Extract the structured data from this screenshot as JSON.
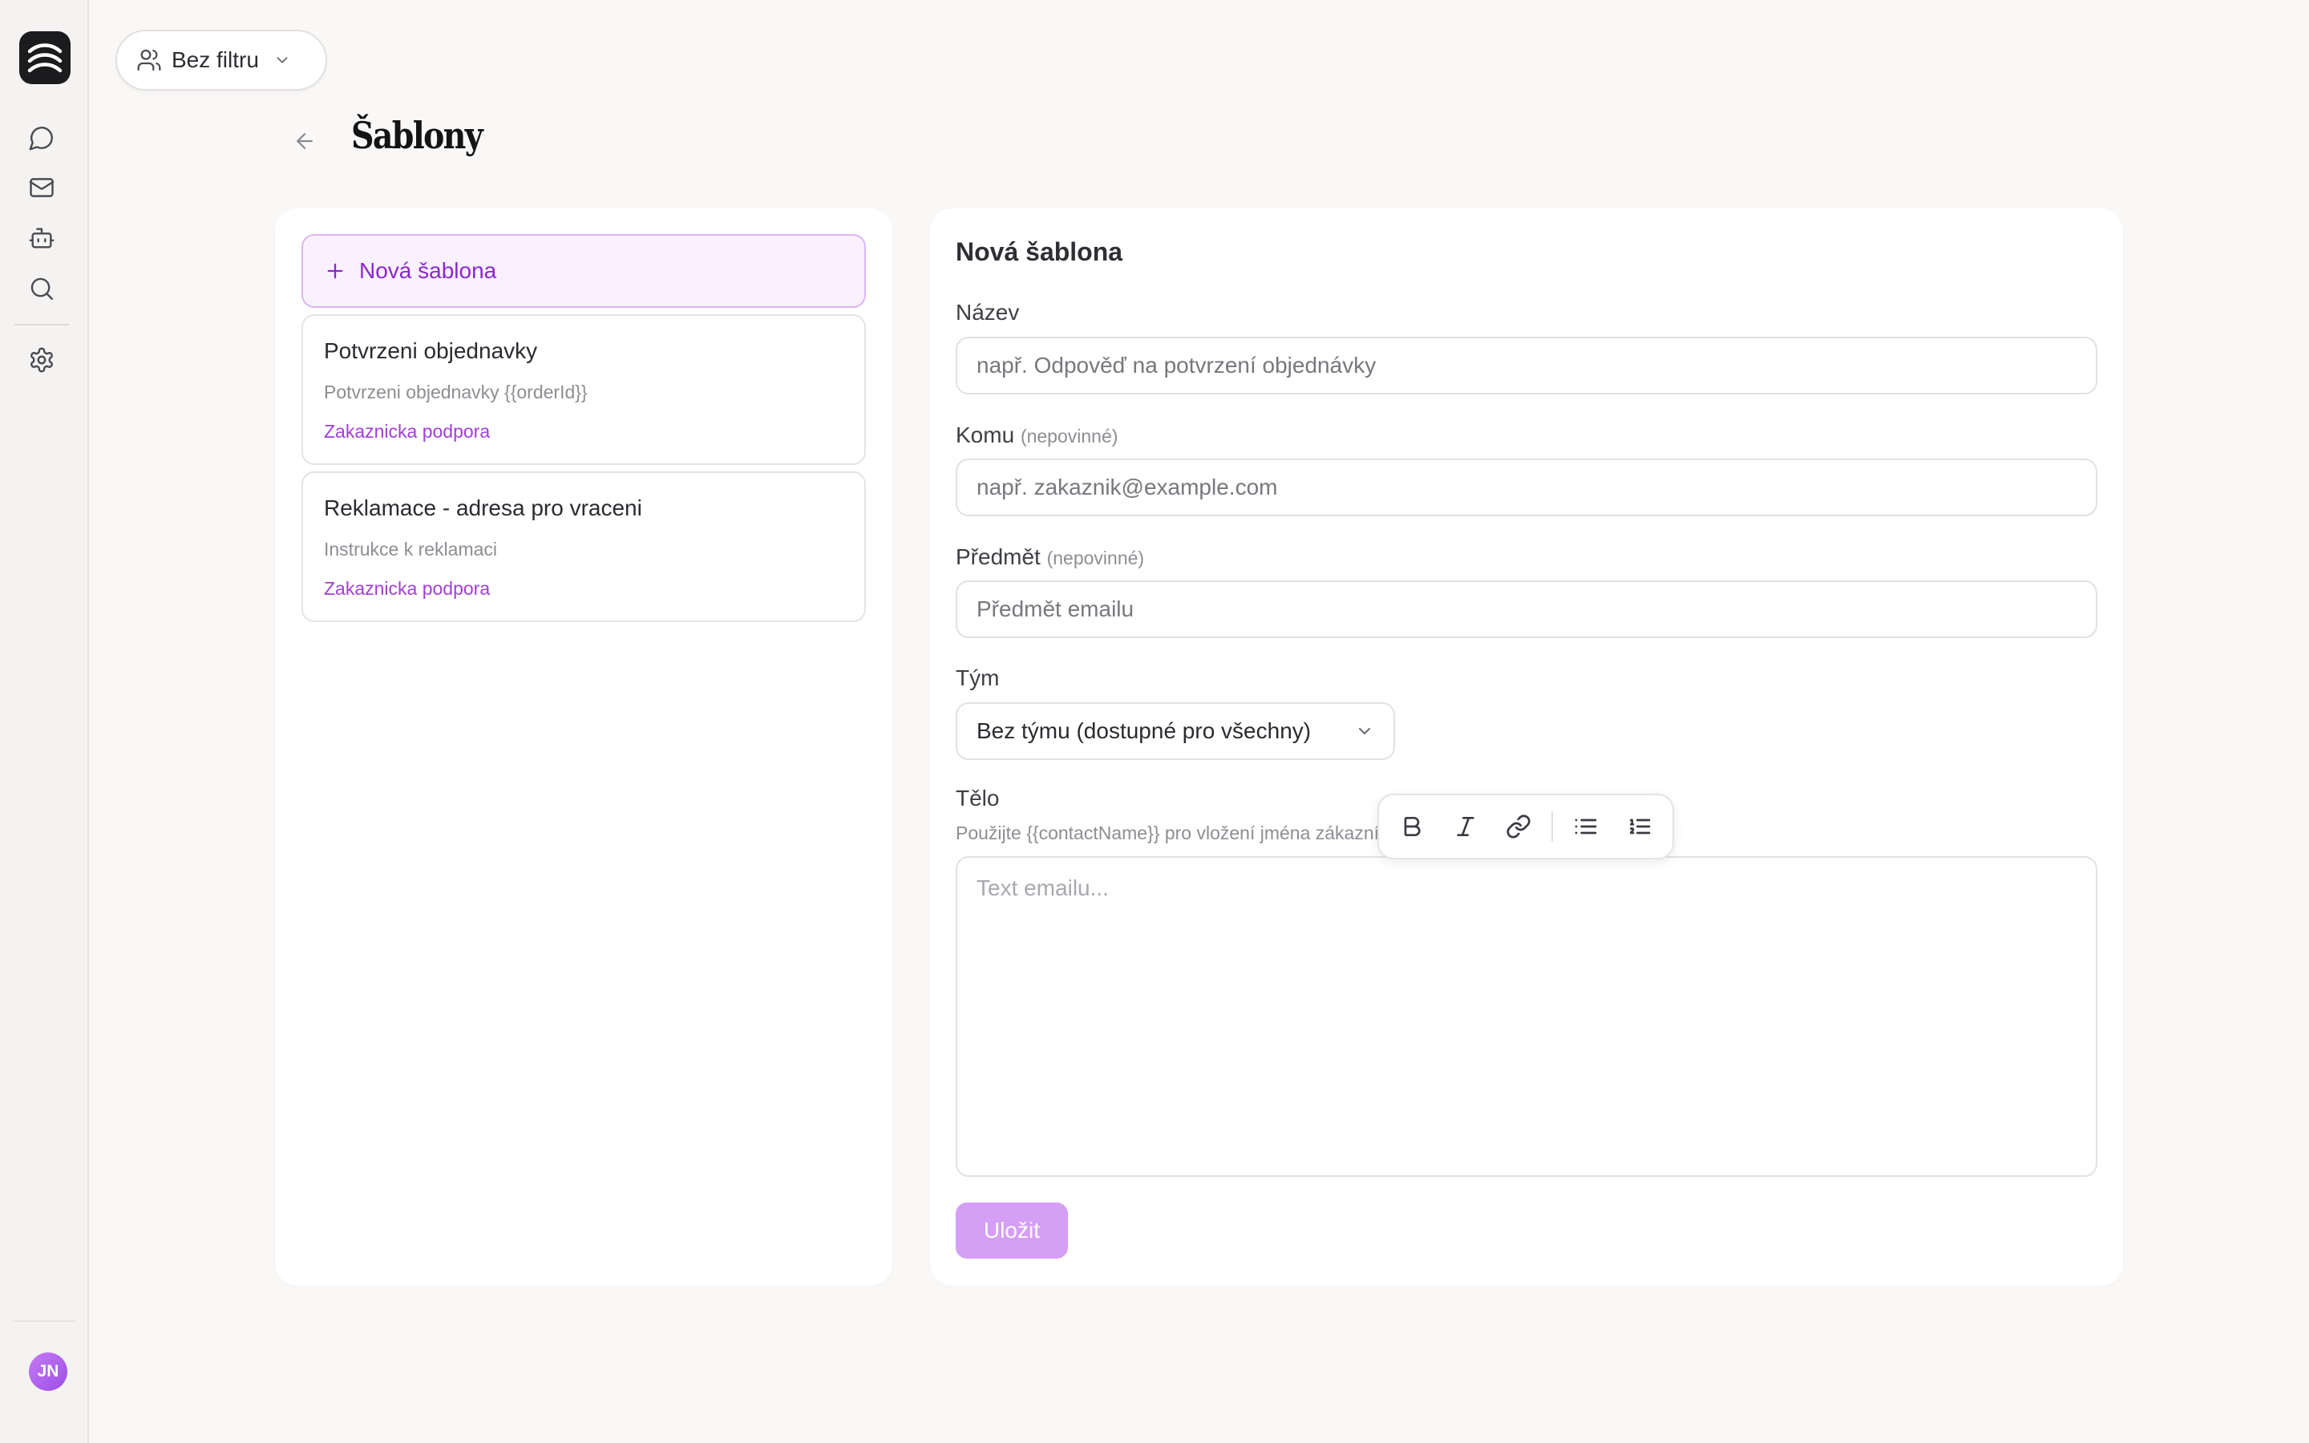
{
  "sidebar": {
    "avatar_initials": "JN",
    "items": [
      {
        "name": "chat",
        "icon": "chat-bubble-icon"
      },
      {
        "name": "mail",
        "icon": "mail-icon"
      },
      {
        "name": "bot",
        "icon": "bot-icon"
      },
      {
        "name": "search",
        "icon": "search-icon"
      },
      {
        "name": "settings",
        "icon": "gear-icon"
      }
    ]
  },
  "topbar": {
    "filter_label": "Bez filtru"
  },
  "header": {
    "title": "Šablony"
  },
  "templates": {
    "new_label": "Nová šablona",
    "items": [
      {
        "title": "Potvrzeni objednavky",
        "subject": "Potvrzeni objednavky {{orderId}}",
        "team": "Zakaznicka podpora"
      },
      {
        "title": "Reklamace - adresa pro vraceni",
        "subject": "Instrukce k reklamaci",
        "team": "Zakaznicka podpora"
      }
    ]
  },
  "form": {
    "title": "Nová šablona",
    "name": {
      "label": "Název",
      "placeholder": "např. Odpověď na potvrzení objednávky"
    },
    "to": {
      "label": "Komu",
      "optional": "(nepovinné)",
      "placeholder": "např. zakaznik@example.com"
    },
    "subject": {
      "label": "Předmět",
      "optional": "(nepovinné)",
      "placeholder": "Předmět emailu"
    },
    "team": {
      "label": "Tým",
      "value": "Bez týmu (dostupné pro všechny)"
    },
    "body": {
      "label": "Tělo",
      "hint": "Použijte {{contactName}} pro vložení jména zákazníka",
      "placeholder": "Text emailu..."
    },
    "save_label": "Uložit"
  },
  "colors": {
    "accent": "#8a28cc",
    "accent_light": "#f9f1fe",
    "save_disabled": "#d59ff5"
  }
}
